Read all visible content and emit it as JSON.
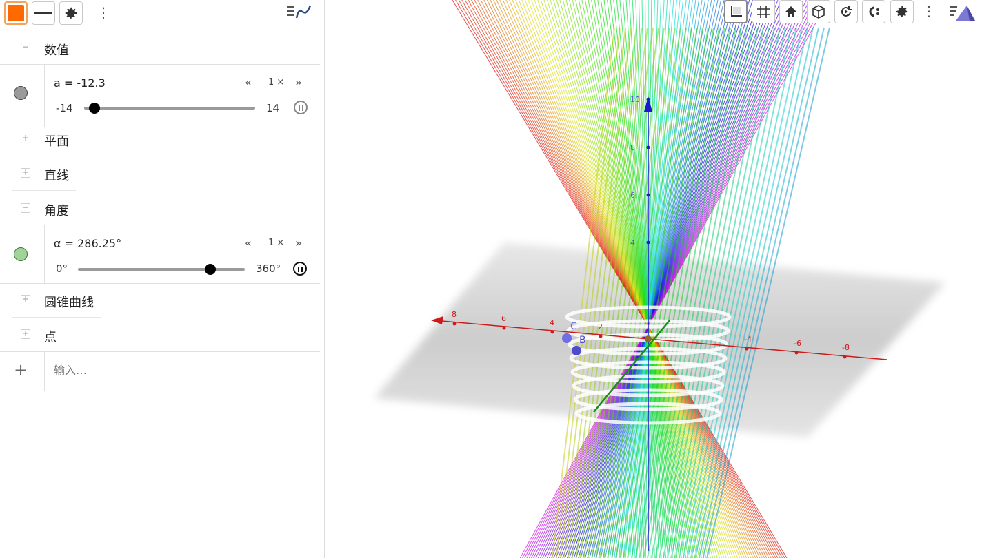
{
  "toolbar": {
    "style_color": "#ff6a00",
    "icons": [
      "color-swatch-icon",
      "line-style-icon",
      "settings-icon",
      "more-icon",
      "graph-view-icon"
    ]
  },
  "algebra": {
    "sections": {
      "numbers": {
        "label": "数值",
        "toggle": "−"
      },
      "planes": {
        "label": "平面",
        "toggle": "+"
      },
      "lines": {
        "label": "直线",
        "toggle": "+"
      },
      "angles": {
        "label": "角度",
        "toggle": "−"
      },
      "conics": {
        "label": "圆锥曲线",
        "toggle": "+"
      },
      "points": {
        "label": "点",
        "toggle": "+"
      }
    },
    "slider_a": {
      "definition": "a = -12.3",
      "min": "-14",
      "max": "14",
      "value": -12.3,
      "speed": "1 ×",
      "color": "#9a9a9a"
    },
    "slider_alpha": {
      "definition": "α = 286.25°",
      "min": "0°",
      "max": "360°",
      "value": 286.25,
      "speed": "1 ×",
      "color": "#9fd39a"
    },
    "input": {
      "placeholder": "输入…",
      "plus": "+"
    }
  },
  "graphics": {
    "axes": {
      "x_ticks": [
        "8",
        "6",
        "4",
        "2",
        "-4",
        "-6",
        "-8"
      ],
      "z_ticks": [
        "10",
        "8",
        "6",
        "4"
      ],
      "x_color": "#cc1a1a",
      "y_color": "#1a8c1a",
      "z_color": "#1a1acc"
    },
    "points": [
      {
        "name": "C",
        "color": "#6e6ee6"
      },
      {
        "name": "B",
        "color": "#4d4dcc"
      }
    ],
    "toolbar_icons": [
      "axes-icon",
      "grid-icon",
      "home-icon",
      "cube-view-icon",
      "rotate-icon",
      "capture-icon",
      "settings-icon",
      "more-icon",
      "perspective-icon"
    ]
  },
  "controls": {
    "rewind": "«",
    "forward": "»"
  }
}
